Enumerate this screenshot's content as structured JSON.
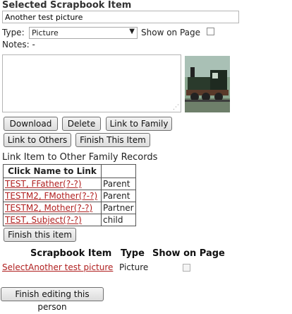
{
  "header": {
    "title": "Selected Scrapbook Item"
  },
  "item": {
    "name_value": "Another test picture",
    "type_label": "Type:",
    "type_selected": "Picture",
    "show_on_page_label": "Show on Page",
    "notes_label": "Notes: -"
  },
  "buttons": {
    "download": "Download",
    "delete": "Delete",
    "link_family": "Link to Family",
    "link_others": "Link to Others",
    "finish_item": "Finish This Item"
  },
  "links_section": {
    "title": "Link Item to Other Family Records",
    "column_header": "Click Name to Link",
    "rows": [
      {
        "name": "TEST, FFather(?-?)",
        "relation": "Parent"
      },
      {
        "name": "TESTM2, FMother(?-?)",
        "relation": "Parent"
      },
      {
        "name": "TESTM2, Mother(?-?)",
        "relation": "Partner"
      },
      {
        "name": "TEST, Subject(?-?)",
        "relation": "child"
      }
    ],
    "finish_button": "Finish this item"
  },
  "scrapbook_list": {
    "headers": {
      "item": "Scrapbook Item",
      "type": "Type",
      "show": "Show on Page"
    },
    "rows": [
      {
        "select": "Select",
        "name": "Another test picture",
        "type": "Picture"
      }
    ]
  },
  "footer": {
    "finish_person": "Finish editing this person"
  }
}
